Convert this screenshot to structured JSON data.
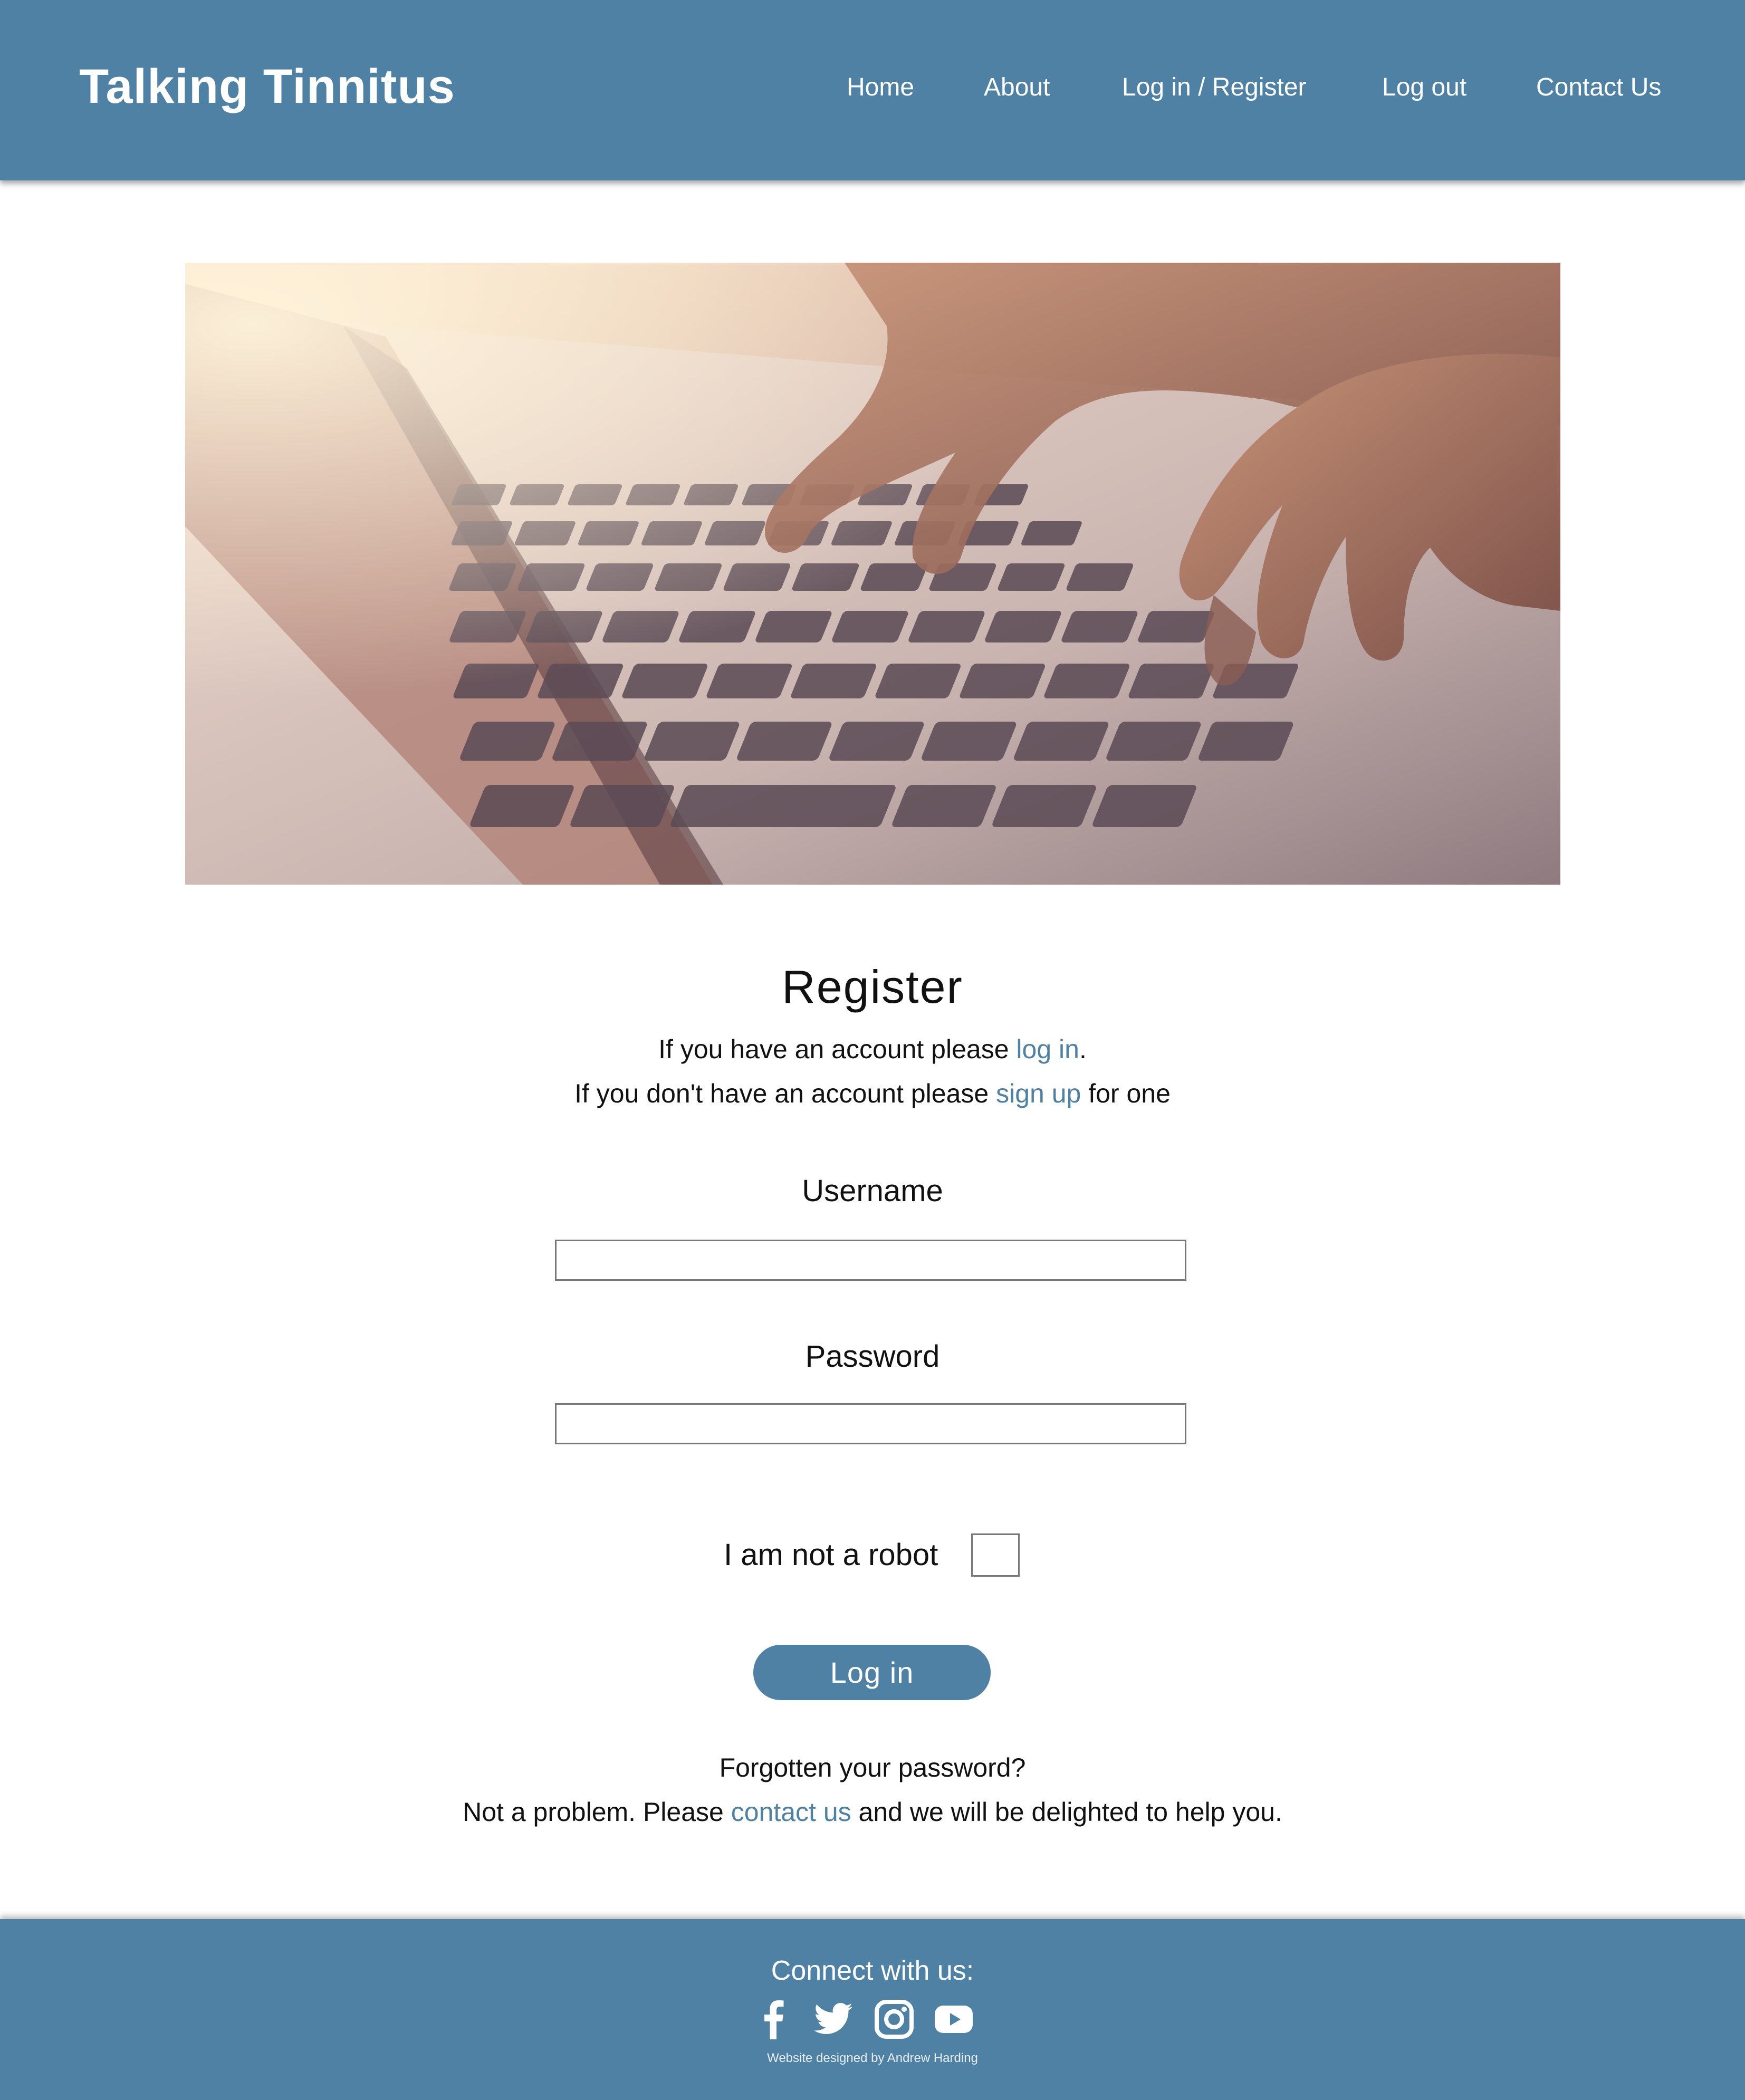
{
  "header": {
    "brand": "Talking Tinnitus",
    "nav": [
      "Home",
      "About",
      "Log in / Register",
      "Log out",
      "Contact Us"
    ]
  },
  "colors": {
    "primary": "#4e81a4",
    "link": "#4e81a4"
  },
  "hero": {
    "icon": "laptop-typing-photo"
  },
  "register": {
    "title": "Register",
    "line1_pre": "If you have an account please ",
    "line1_link": "log in",
    "line1_post": ".",
    "line2_pre": "If you don't have an account please ",
    "line2_link": "sign up",
    "line2_post": " for one",
    "username_label": "Username",
    "username_value": "",
    "password_label": "Password",
    "password_value": "",
    "robot_label": "I am not a robot",
    "robot_checked": false,
    "submit_label": "Log in",
    "forgot_line": "Forgotten your password?",
    "help_pre": "Not a problem. Please ",
    "help_link": "contact us",
    "help_post": " and we will be delighted to help you."
  },
  "footer": {
    "connect": "Connect with us:",
    "social": [
      "facebook-icon",
      "twitter-icon",
      "instagram-icon",
      "youtube-icon"
    ],
    "credit": "Website designed by Andrew Harding"
  }
}
